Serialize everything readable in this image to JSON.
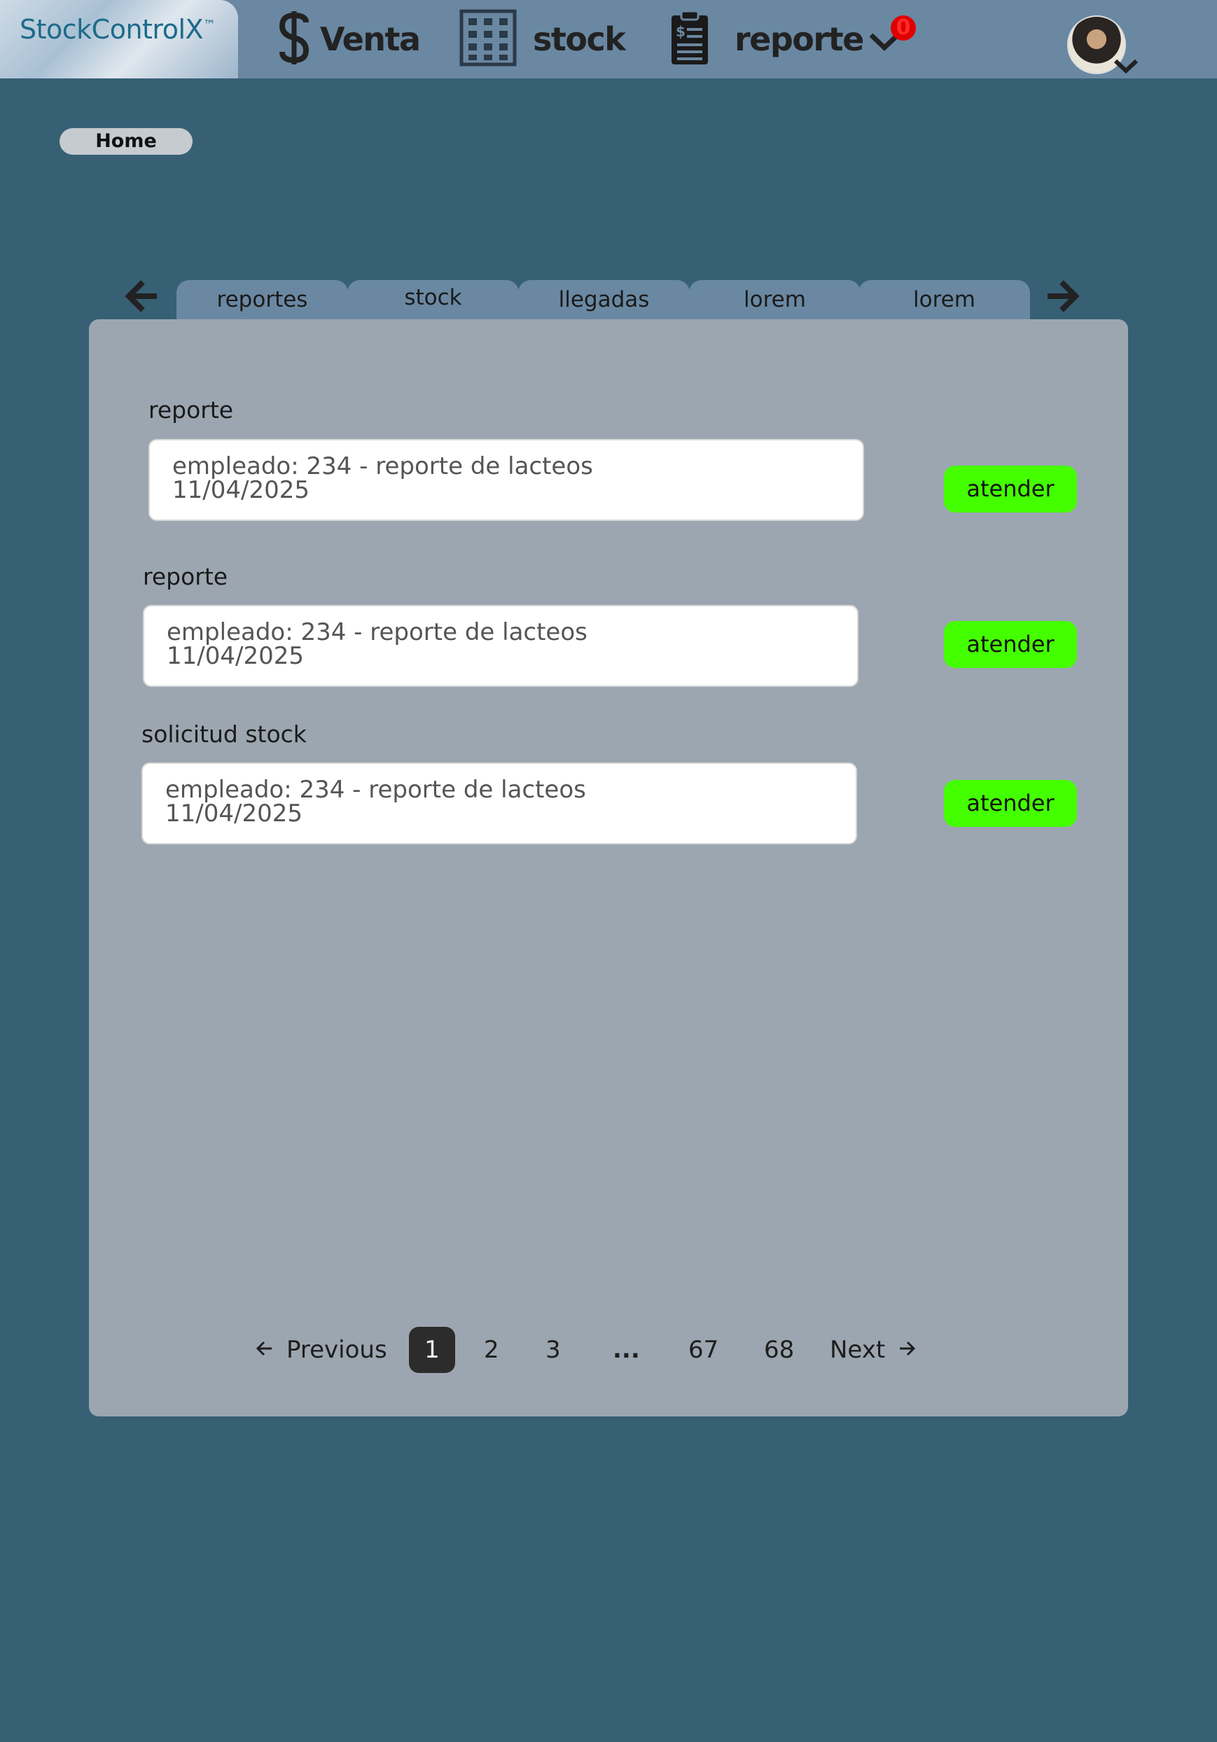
{
  "header": {
    "logo_text": "StockControlX",
    "logo_mark": "™",
    "nav": [
      {
        "label": "Venta",
        "icon": "dollar-icon"
      },
      {
        "label": "stock",
        "icon": "shelves-icon"
      },
      {
        "label": "reporte",
        "icon": "report-clipboard-icon"
      }
    ],
    "notification_count": "0"
  },
  "breadcrumb": {
    "home": "Home"
  },
  "tabs": [
    "reportes",
    "stock",
    "llegadas",
    "lorem",
    "lorem"
  ],
  "items": [
    {
      "title": "reporte",
      "line1": "empleado: 234 - reporte de lacteos",
      "line2": "11/04/2025",
      "action": "atender"
    },
    {
      "title": "reporte",
      "line1": "empleado: 234 - reporte de lacteos",
      "line2": "11/04/2025",
      "action": "atender"
    },
    {
      "title": "solicitud stock",
      "line1": "empleado: 234 - reporte de lacteos",
      "line2": "11/04/2025",
      "action": "atender"
    }
  ],
  "pagination": {
    "previous": "Previous",
    "next": "Next",
    "pages": [
      "1",
      "2",
      "3",
      "...",
      "67",
      "68"
    ],
    "current": "1"
  },
  "colors": {
    "background": "#376075",
    "topbar": "#6a88a2",
    "panel": "#9ca6b0",
    "action_button": "#44ff00",
    "badge": "#e00000"
  }
}
